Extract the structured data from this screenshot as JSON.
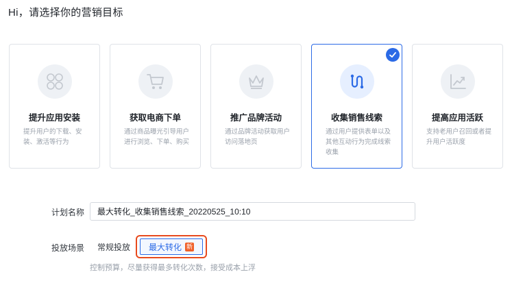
{
  "heading": "Hi，请选择你的营销目标",
  "cards": [
    {
      "title": "提升应用安装",
      "desc": "提升用户的下载、安装、激活等行为",
      "icon": "app-grid-icon",
      "selected": false
    },
    {
      "title": "获取电商下单",
      "desc": "通过商品曝光引导用户进行浏览、下单、购买",
      "icon": "shopping-cart-icon",
      "selected": false
    },
    {
      "title": "推广品牌活动",
      "desc": "通过品牌活动获取用户访问落地页",
      "icon": "crown-icon",
      "selected": false
    },
    {
      "title": "收集销售线索",
      "desc": "通过用户提供表单以及其他互动行为完成线索收集",
      "icon": "funnel-path-icon",
      "selected": true
    },
    {
      "title": "提高应用活跃",
      "desc": "支持老用户召回或者提升用户活跃度",
      "icon": "trend-chart-icon",
      "selected": false
    }
  ],
  "form": {
    "plan_name_label": "计划名称",
    "plan_name_value": "最大转化_收集销售线索_20220525_10:10",
    "scene_label": "投放场景",
    "options": [
      {
        "label": "常规投放",
        "selected": false
      },
      {
        "label": "最大转化",
        "selected": true,
        "badge": "新"
      }
    ],
    "hint": "控制预算，尽量获得最多转化次数，接受成本上浮"
  },
  "colors": {
    "accent": "#2b6ae6",
    "highlight": "#e84a1d",
    "new_badge": "#f0602a"
  }
}
